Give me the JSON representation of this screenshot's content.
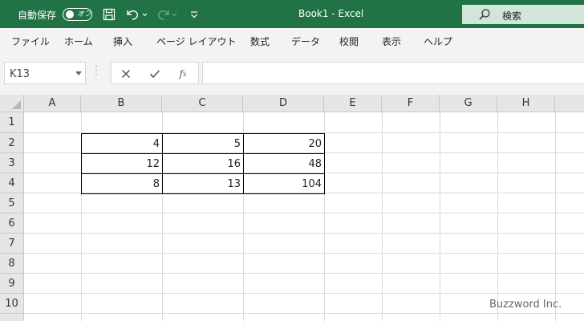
{
  "titlebar": {
    "autosave_label": "自動保存",
    "autosave_toggle": "オフ",
    "doc_title": "Book1  -  Excel",
    "search_placeholder": "検索",
    "icons": [
      "save-icon",
      "undo-icon",
      "redo-icon",
      "customize-icon",
      "search-icon"
    ]
  },
  "menu": {
    "items": [
      "ファイル",
      "ホーム",
      "挿入",
      "ページ レイアウト",
      "数式",
      "データ",
      "校閲",
      "表示",
      "ヘルプ"
    ]
  },
  "formula_bar": {
    "name_box": "K13",
    "formula": "",
    "icons": [
      "cancel-icon",
      "enter-icon",
      "fx-icon"
    ]
  },
  "sheet": {
    "columns": [
      "A",
      "B",
      "C",
      "D",
      "E",
      "F",
      "G",
      "H"
    ],
    "rows": [
      "1",
      "2",
      "3",
      "4",
      "5",
      "6",
      "7",
      "8",
      "9",
      "10"
    ],
    "table": [
      [
        "4",
        "5",
        "20"
      ],
      [
        "12",
        "16",
        "48"
      ],
      [
        "8",
        "13",
        "104"
      ]
    ]
  },
  "watermark": "Buzzword Inc.",
  "colors": {
    "title_bg": "#217346",
    "search_bg": "#d2e5da",
    "ribbon_bg": "#f3f3f3",
    "header_bg": "#e6e6e6",
    "gridline": "#dadada"
  }
}
